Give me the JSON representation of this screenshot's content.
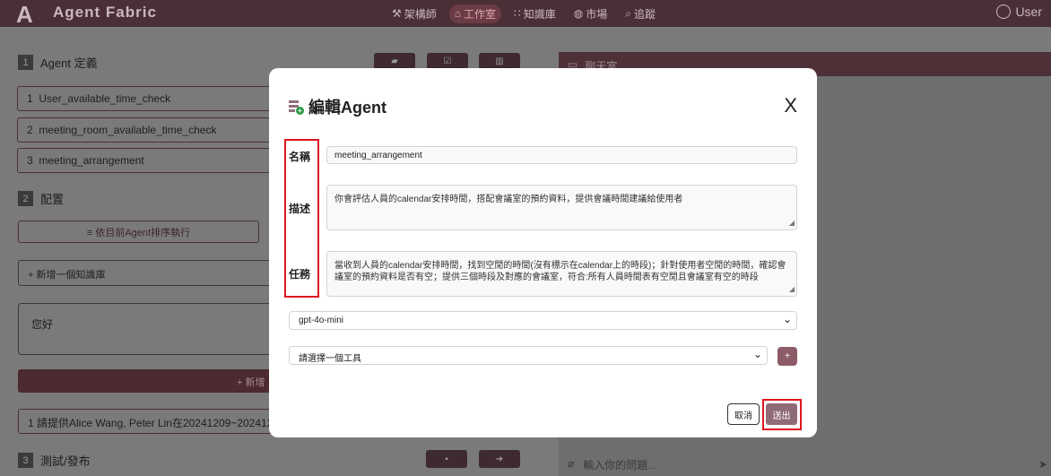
{
  "app": {
    "logo_glyph": "A",
    "name": "Agent Fabric"
  },
  "nav": [
    {
      "icon": "architect-icon",
      "glyph": "⚒",
      "label": "架構師"
    },
    {
      "icon": "studio-icon",
      "glyph": "⌂",
      "label": "工作室",
      "active": true
    },
    {
      "icon": "grid-icon",
      "glyph": "∷",
      "label": "知識庫"
    },
    {
      "icon": "globe-icon",
      "glyph": "◍",
      "label": "市場"
    },
    {
      "icon": "search-icon",
      "glyph": "⌕",
      "label": "追蹤"
    }
  ],
  "user": {
    "label": "User",
    "icon": "user-icon"
  },
  "left": {
    "section1": {
      "num": "1",
      "title": "Agent 定義"
    },
    "agents": [
      {
        "index": "1",
        "name": "User_available_time_check"
      },
      {
        "index": "2",
        "name": "meeting_room_available_time_check"
      },
      {
        "index": "3",
        "name": "meeting_arrangement"
      }
    ],
    "section2": {
      "num": "2",
      "title": "配置"
    },
    "sort_button": "≡ 依目前Agent排序執行",
    "kb_button": "+ 新增一個知識庫",
    "greeting": "您好",
    "add_bar": "+ 新增",
    "query": "1  請提供Alice Wang, Peter Lin在20241209~2024121",
    "section3": {
      "num": "3",
      "title": "測試/發布"
    }
  },
  "chat": {
    "title": "聊天室",
    "input_placeholder": "輸入你的問題..."
  },
  "modal": {
    "title": "編輯Agent",
    "close_label": "X",
    "labels": {
      "name": "名稱",
      "description": "描述",
      "task": "任務"
    },
    "name_value": "meeting_arrangement",
    "description_value": "你會評估人員的calendar安排時間，搭配會議室的預約資料，提供會議時間建議給使用者",
    "task_value": "當收到人員的calendar安排時間，找到空閒的時間(沒有標示在calendar上的時段)；針對使用者空閒的時間，確認會議室的預約資料是否有空；提供三個時段及對應的會議室，符合:所有人員時間表有空閒且會議室有空的時段",
    "model_value": "gpt-4o-mini",
    "tool_placeholder": "請選擇一個工具",
    "tool_add_label": "+",
    "cancel_label": "取消",
    "submit_label": "送出"
  },
  "colors": {
    "brand": "#4a2f37",
    "accent": "#8f6b76",
    "highlight": "#e0141e"
  }
}
